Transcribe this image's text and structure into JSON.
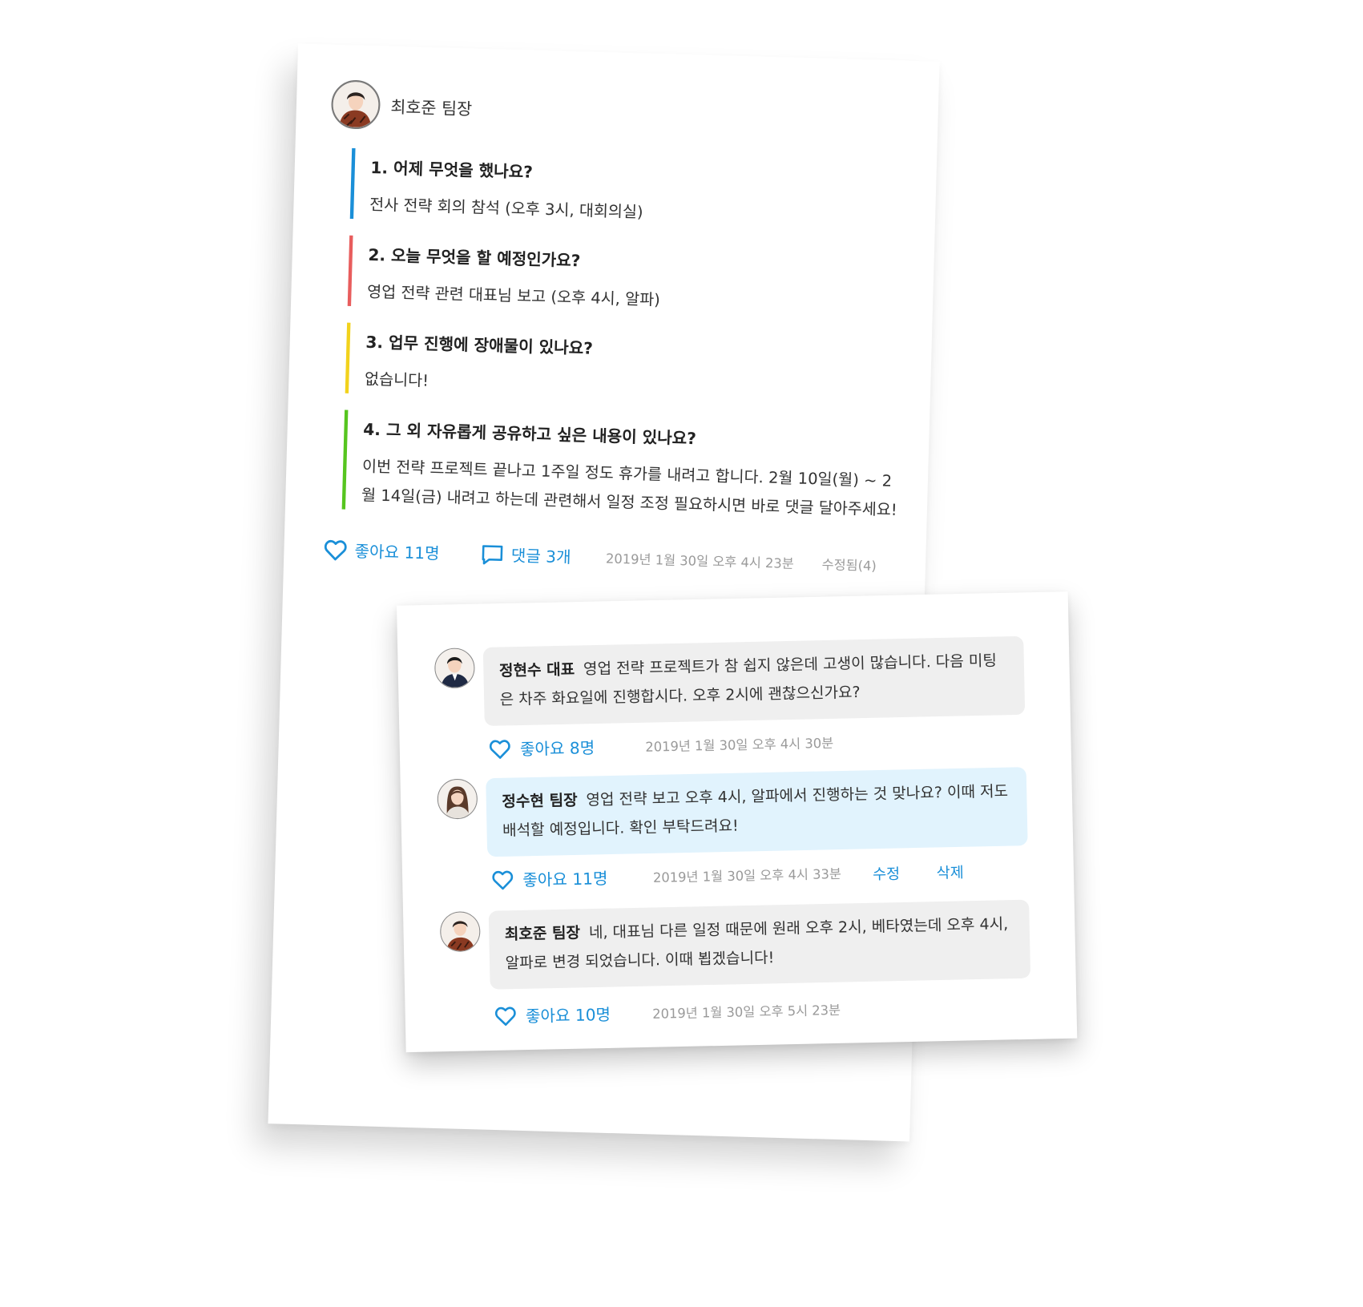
{
  "post": {
    "author": "최호준 팀장",
    "questions": [
      {
        "q": "1. 어제 무엇을 했나요?",
        "a": "전사 전략 회의 참석 (오후 3시, 대회의실)",
        "color": "#1a8fd8"
      },
      {
        "q": "2. 오늘 무엇을 할 예정인가요?",
        "a": "영업 전략 관련 대표님 보고 (오후 4시, 알파)",
        "color": "#e85d5d"
      },
      {
        "q": "3. 업무 진행에 장애물이 있나요?",
        "a": "없습니다!",
        "color": "#f2d21c"
      },
      {
        "q": "4. 그 외 자유롭게 공유하고 싶은 내용이 있나요?",
        "a": "이번 전략 프로젝트 끝나고 1주일 정도 휴가를 내려고 합니다. 2월 10일(월) ~ 2월 14일(금) 내려고 하는데 관련해서 일정 조정 필요하시면 바로 댓글 달아주세요!",
        "color": "#56c51f"
      }
    ],
    "likes": "좋아요 11명",
    "comments": "댓글 3개",
    "timestamp": "2019년 1월 30일 오후 4시 23분",
    "edited": "수정됨(4)"
  },
  "comments": [
    {
      "author": "정현수 대표",
      "text": "영업 전략 프로젝트가 참 쉽지 않은데 고생이 많습니다. 다음 미팅은 차주 화요일에 진행합시다. 오후 2시에 괜찮으신가요?",
      "likes": "좋아요 8명",
      "timestamp": "2019년 1월 30일 오후 4시 30분"
    },
    {
      "author": "정수현 팀장",
      "text": "영업 전략 보고 오후 4시, 알파에서 진행하는 것 맞나요? 이때 저도 배석할 예정입니다. 확인 부탁드려요!",
      "likes": "좋아요 11명",
      "timestamp": "2019년 1월 30일 오후 4시 33분",
      "edit_label": "수정",
      "delete_label": "삭제"
    },
    {
      "author": "최호준 팀장",
      "text": "네, 대표님 다른 일정 때문에 원래 오후 2시, 베타였는데 오후 4시, 알파로 변경 되었습니다. 이때 뵙겠습니다!",
      "likes": "좋아요 10명",
      "timestamp": "2019년 1월 30일 오후 5시 23분"
    }
  ],
  "colors": {
    "accent": "#1a8fd8",
    "own_comment_bg": "#e1f3fd",
    "comment_bg": "#efefef"
  }
}
